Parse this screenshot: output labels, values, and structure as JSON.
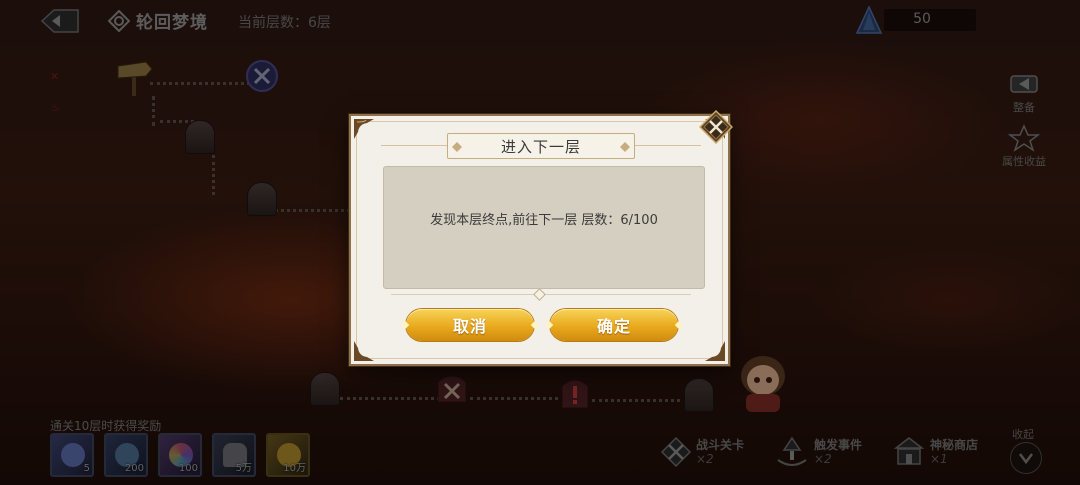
{
  "header": {
    "title": "轮回梦境",
    "current_floor": "当前层数：6层",
    "gem_count": "50"
  },
  "side_buttons": {
    "equipment": "整备",
    "attribute_income": "属性收益"
  },
  "rewards": {
    "title": "通关10层时获得奖励",
    "items": [
      {
        "qty": "5",
        "icon": "crystal-icon"
      },
      {
        "qty": "200",
        "icon": "potion-icon"
      },
      {
        "qty": "100",
        "icon": "orb-icon"
      },
      {
        "qty": "5万",
        "icon": "helmet-icon"
      },
      {
        "qty": "10万",
        "icon": "gold-coin-icon"
      }
    ]
  },
  "legend": {
    "battle": {
      "name": "战斗关卡",
      "count": "×2"
    },
    "event": {
      "name": "触发事件",
      "count": "×2"
    },
    "shop": {
      "name": "神秘商店",
      "count": "×1"
    },
    "collapse": "收起"
  },
  "dialog": {
    "title": "进入下一层",
    "message": "发现本层终点,前往下一层 层数：6/100",
    "cancel_label": "取消",
    "confirm_label": "确定"
  },
  "colors": {
    "button_gold": "#e9a91c",
    "dialog_bg": "#f3f0e9",
    "message_bg": "#d4cfc0",
    "frame_brown": "#8f7048"
  }
}
